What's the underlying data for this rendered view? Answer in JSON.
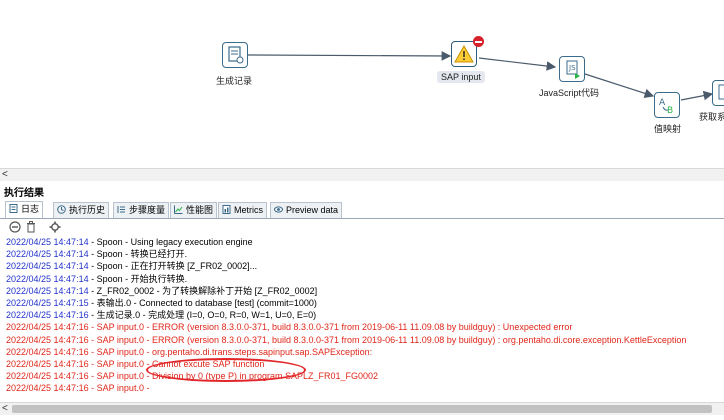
{
  "canvas": {
    "steps": [
      {
        "label": "生成记录",
        "icon": "generate-rows-icon"
      },
      {
        "label": "SAP input",
        "icon": "warning-icon",
        "badge": "error-badge"
      },
      {
        "label": "JavaScript代码",
        "icon": "javascript-icon"
      },
      {
        "label": "值映射",
        "icon": "value-mapper-icon"
      },
      {
        "label": "获取系",
        "icon": "system-info-icon"
      }
    ],
    "scroll_left": "<"
  },
  "results": {
    "title": "执行结果",
    "tabs": [
      {
        "label": "日志",
        "icon": "log-icon"
      },
      {
        "label": "执行历史",
        "icon": "history-icon"
      },
      {
        "label": "步骤度量",
        "icon": "step-metrics-icon"
      },
      {
        "label": "性能图",
        "icon": "performance-graph-icon"
      },
      {
        "label": "Metrics",
        "icon": "metrics-icon"
      },
      {
        "label": "Preview data",
        "icon": "preview-icon"
      }
    ],
    "toolbar": [
      "stop-icon",
      "clear-log-icon",
      "log-settings-icon"
    ]
  },
  "log": [
    {
      "ts": "2022/04/25 14:47:14",
      "msg": " - Spoon - Using legacy execution engine",
      "error": false
    },
    {
      "ts": "2022/04/25 14:47:14",
      "msg": " - Spoon - 转换已经打开.",
      "error": false
    },
    {
      "ts": "2022/04/25 14:47:14",
      "msg": " - Spoon - 正在打开转换 [Z_FR02_0002]...",
      "error": false
    },
    {
      "ts": "2022/04/25 14:47:14",
      "msg": " - Spoon - 开始执行转换.",
      "error": false
    },
    {
      "ts": "2022/04/25 14:47:14",
      "msg": " - Z_FR02_0002 - 为了转换解除补丁开始  [Z_FR02_0002]",
      "error": false
    },
    {
      "ts": "2022/04/25 14:47:15",
      "msg": " - 表输出.0 - Connected to database [test] (commit=1000)",
      "error": false
    },
    {
      "ts": "2022/04/25 14:47:16",
      "msg": " - 生成记录.0 - 完成处理 (I=0, O=0, R=0, W=1, U=0, E=0)",
      "error": false
    },
    {
      "ts": "2022/04/25 14:47:16",
      "msg": " - SAP input.0 - ERROR (version 8.3.0.0-371, build 8.3.0.0-371 from 2019-06-11 11.09.08 by buildguy) : Unexpected error",
      "error": true
    },
    {
      "ts": "2022/04/25 14:47:16",
      "msg": " - SAP input.0 - ERROR (version 8.3.0.0-371, build 8.3.0.0-371 from 2019-06-11 11.09.08 by buildguy) : org.pentaho.di.core.exception.KettleException",
      "error": true
    },
    {
      "ts": "2022/04/25 14:47:16",
      "msg": " - SAP input.0 - org.pentaho.di.trans.steps.sapinput.sap.SAPException:",
      "error": true
    },
    {
      "ts": "2022/04/25 14:47:16",
      "msg": " - SAP input.0 - Cannot excute SAP function",
      "error": true
    },
    {
      "ts": "2022/04/25 14:47:16",
      "msg": " - SAP input.0 - Division by 0 (type P) in program SAPLZ_FR01_FG0002",
      "error": true
    },
    {
      "ts": "2022/04/25 14:47:16",
      "msg": " - SAP input.0 -",
      "error": true
    }
  ],
  "colors": {
    "timestamp": "#2233cc",
    "error": "#e0261a",
    "annotation": "#e2262a"
  }
}
